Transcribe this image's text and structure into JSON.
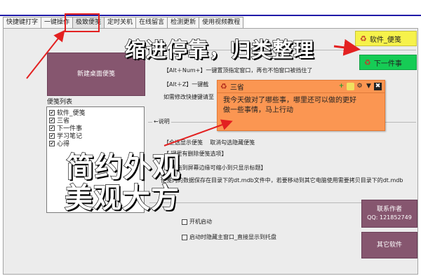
{
  "tabs": [
    "快捷键打字",
    "一键操作",
    "极致便笺",
    "定时关机",
    "在线留言",
    "检测更新",
    "使用视频教程"
  ],
  "new_desktop_note_label": "新建桌面便笺",
  "hotkeys": {
    "line1": "【Alt＋Num+】一键置顶指定窗口，再也不怕窗口被挡住了",
    "line2": "【Alt＋Z】一键截",
    "line3": "如需修改快捷键请至"
  },
  "list_title": "便笺列表",
  "list_items": [
    "软件_便笺",
    "三省",
    "下一件事",
    "学习笔记",
    "心得"
  ],
  "desc": {
    "heading": "说明",
    "l1a": "【",
    "l1b": "全选显示便笺",
    "l1c": "取消勾选隐藏便笺",
    "l2": "【    键里有删除便笺选项】",
    "l3": "【    笺拖到屏幕边缘可缩小到只显示标题】",
    "l4": "便笺内的数据保存在目录下的dt.mdb文件中，若要移动到其它电脑使用需要拷贝目录下的dt.mdb"
  },
  "checkboxes": {
    "startup": "开机启动",
    "tray": "启动时隐藏主窗口_直接显示到托盘"
  },
  "author_btn": {
    "line1": "联系作者",
    "line2": "QQ: 121852749"
  },
  "other_soft_btn": "其它软件",
  "note": {
    "title": "三省",
    "body1": "我今天做对了哪些事，哪里还可以做的更好",
    "body2": "做一些事情，马上行动",
    "add_icon": "+",
    "gear_icon": "⚙",
    "pin_icon": "▼",
    "close_icon": "✖"
  },
  "minicards": {
    "card1": "软件_便笺",
    "card2": "下一件事"
  },
  "annotations": {
    "top": "缩进停靠，归类整理",
    "bottom1": "简约外观",
    "bottom2": "美观大方"
  },
  "colors": {
    "accent_red": "#e32121",
    "note_orange": "#fb9652",
    "card_yellow": "#f6f24b",
    "card_green": "#16cc55",
    "button_purple": "#86566f"
  }
}
